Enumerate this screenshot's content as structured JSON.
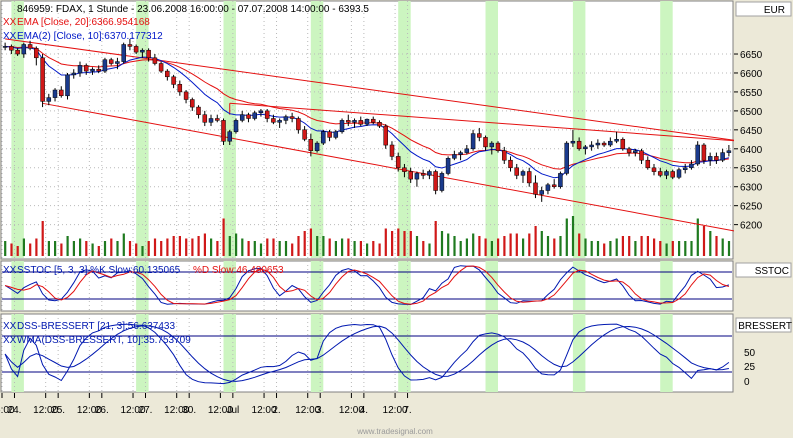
{
  "header": {
    "title": "846959: FDAX, 1 Stunde - 23.06.2008 16:00:00 - 07.07.2008 14:00:00 - 6393.5",
    "ema20": "EMA [Close, 20]:6366.954168",
    "ema10": "EMA(2) [Close, 10]:6370.177312",
    "currency": "EUR"
  },
  "panes": {
    "sstoc": {
      "title_k": "SSTOC [5, 3, 3] %K Slow:60.135065",
      "title_d": "%D Slow:46.480653",
      "axis_label": "SSTOC"
    },
    "dss": {
      "title1": "DSS-BRESSERT [21, 3]:56.637433",
      "title2": "WMA(DSS-BRESSERT, 10]:35.753709",
      "axis_label": "BRESSERT",
      "ticks": [
        "50",
        "25",
        "0"
      ]
    }
  },
  "x_labels": [
    "16:00",
    "24.",
    "12:00",
    "25.",
    "12:00",
    "26.",
    "12:00",
    "27.",
    "12:00",
    "30.",
    "12:00",
    "Jul",
    "12:00",
    "2.",
    "12:00",
    "3.",
    "12:00",
    "4.",
    "12:00",
    "7."
  ],
  "watermark": "www.tradesignal.com",
  "colors": {
    "up": "#1a3a8c",
    "down": "#d01818",
    "ema20": "#e41010",
    "ema10": "#0018c8",
    "green_band": "#ccf5c0",
    "grid": "#b9b9b9",
    "background": "#ffffff",
    "k_line": "#0018b0",
    "d_line": "#e41010"
  },
  "chart_data": [
    {
      "type": "candlestick",
      "title": "846959: FDAX, 1 Stunde - 23.06.2008 16:00:00 - 07.07.2008 14:00:00 - 6393.5",
      "y_ticks": [
        6650,
        6600,
        6550,
        6500,
        6450,
        6400,
        6350,
        6300,
        6250,
        6200
      ],
      "ylim": [
        6170,
        6745
      ],
      "volume_unit": "relative",
      "candles": [
        [
          6668,
          6680,
          6660,
          6670,
          0.3
        ],
        [
          6670,
          6675,
          6650,
          6660,
          0.25
        ],
        [
          6660,
          6665,
          6645,
          6650,
          0.2
        ],
        [
          6650,
          6680,
          6640,
          6675,
          0.35
        ],
        [
          6675,
          6685,
          6660,
          6665,
          0.25
        ],
        [
          6665,
          6670,
          6620,
          6640,
          0.35
        ],
        [
          6640,
          6650,
          6510,
          6525,
          0.7
        ],
        [
          6525,
          6545,
          6515,
          6535,
          0.3
        ],
        [
          6535,
          6560,
          6525,
          6555,
          0.3
        ],
        [
          6555,
          6565,
          6535,
          6540,
          0.25
        ],
        [
          6540,
          6600,
          6530,
          6595,
          0.4
        ],
        [
          6595,
          6610,
          6585,
          6600,
          0.3
        ],
        [
          6600,
          6630,
          6590,
          6620,
          0.35
        ],
        [
          6620,
          6625,
          6595,
          6605,
          0.3
        ],
        [
          6605,
          6615,
          6595,
          6610,
          0.25
        ],
        [
          6610,
          6620,
          6600,
          6605,
          0.2
        ],
        [
          6605,
          6640,
          6600,
          6635,
          0.3
        ],
        [
          6635,
          6640,
          6620,
          6625,
          0.35
        ],
        [
          6625,
          6640,
          6610,
          6630,
          0.3
        ],
        [
          6630,
          6680,
          6625,
          6675,
          0.45
        ],
        [
          6675,
          6690,
          6660,
          6670,
          0.3
        ],
        [
          6670,
          6675,
          6650,
          6655,
          0.25
        ],
        [
          6655,
          6665,
          6640,
          6660,
          0.2
        ],
        [
          6660,
          6665,
          6630,
          6640,
          0.3
        ],
        [
          6640,
          6650,
          6620,
          6625,
          0.35
        ],
        [
          6625,
          6630,
          6600,
          6605,
          0.3
        ],
        [
          6605,
          6610,
          6580,
          6590,
          0.35
        ],
        [
          6590,
          6595,
          6560,
          6570,
          0.4
        ],
        [
          6570,
          6580,
          6540,
          6550,
          0.4
        ],
        [
          6550,
          6555,
          6520,
          6530,
          0.35
        ],
        [
          6530,
          6535,
          6500,
          6510,
          0.35
        ],
        [
          6510,
          6515,
          6480,
          6490,
          0.4
        ],
        [
          6490,
          6500,
          6460,
          6470,
          0.45
        ],
        [
          6470,
          6490,
          6460,
          6480,
          0.35
        ],
        [
          6480,
          6490,
          6470,
          6475,
          0.3
        ],
        [
          6475,
          6480,
          6410,
          6420,
          0.75
        ],
        [
          6420,
          6450,
          6410,
          6445,
          0.4
        ],
        [
          6445,
          6480,
          6440,
          6475,
          0.45
        ],
        [
          6475,
          6500,
          6470,
          6490,
          0.35
        ],
        [
          6490,
          6495,
          6470,
          6480,
          0.3
        ],
        [
          6480,
          6500,
          6475,
          6495,
          0.3
        ],
        [
          6495,
          6505,
          6485,
          6500,
          0.25
        ],
        [
          6500,
          6505,
          6470,
          6480,
          0.35
        ],
        [
          6480,
          6490,
          6465,
          6470,
          0.35
        ],
        [
          6470,
          6480,
          6455,
          6475,
          0.3
        ],
        [
          6475,
          6490,
          6465,
          6485,
          0.3
        ],
        [
          6485,
          6495,
          6470,
          6480,
          0.25
        ],
        [
          6480,
          6485,
          6440,
          6450,
          0.4
        ],
        [
          6450,
          6460,
          6420,
          6425,
          0.5
        ],
        [
          6425,
          6440,
          6380,
          6395,
          0.55
        ],
        [
          6395,
          6420,
          6390,
          6415,
          0.4
        ],
        [
          6415,
          6450,
          6410,
          6445,
          0.4
        ],
        [
          6445,
          6450,
          6420,
          6430,
          0.35
        ],
        [
          6430,
          6450,
          6425,
          6445,
          0.3
        ],
        [
          6445,
          6480,
          6440,
          6475,
          0.35
        ],
        [
          6475,
          6490,
          6460,
          6470,
          0.35
        ],
        [
          6470,
          6480,
          6455,
          6475,
          0.3
        ],
        [
          6475,
          6485,
          6460,
          6465,
          0.3
        ],
        [
          6465,
          6480,
          6460,
          6478,
          0.25
        ],
        [
          6478,
          6485,
          6465,
          6470,
          0.3
        ],
        [
          6470,
          6475,
          6455,
          6460,
          0.25
        ],
        [
          6460,
          6465,
          6400,
          6410,
          0.55
        ],
        [
          6410,
          6420,
          6370,
          6380,
          0.5
        ],
        [
          6380,
          6390,
          6340,
          6350,
          0.55
        ],
        [
          6350,
          6360,
          6325,
          6340,
          0.5
        ],
        [
          6340,
          6350,
          6310,
          6320,
          0.5
        ],
        [
          6320,
          6340,
          6300,
          6335,
          0.4
        ],
        [
          6335,
          6345,
          6320,
          6330,
          0.3
        ],
        [
          6330,
          6345,
          6320,
          6340,
          0.25
        ],
        [
          6340,
          6345,
          6280,
          6290,
          0.7
        ],
        [
          6290,
          6340,
          6285,
          6335,
          0.5
        ],
        [
          6335,
          6380,
          6330,
          6375,
          0.45
        ],
        [
          6375,
          6395,
          6370,
          6385,
          0.4
        ],
        [
          6385,
          6395,
          6370,
          6390,
          0.3
        ],
        [
          6390,
          6410,
          6385,
          6400,
          0.35
        ],
        [
          6400,
          6450,
          6395,
          6440,
          0.45
        ],
        [
          6440,
          6455,
          6420,
          6430,
          0.4
        ],
        [
          6430,
          6435,
          6395,
          6405,
          0.35
        ],
        [
          6405,
          6420,
          6385,
          6415,
          0.3
        ],
        [
          6415,
          6420,
          6390,
          6395,
          0.35
        ],
        [
          6395,
          6405,
          6360,
          6370,
          0.4
        ],
        [
          6370,
          6380,
          6340,
          6350,
          0.45
        ],
        [
          6350,
          6360,
          6320,
          6330,
          0.45
        ],
        [
          6330,
          6345,
          6310,
          6340,
          0.35
        ],
        [
          6340,
          6350,
          6300,
          6310,
          0.45
        ],
        [
          6310,
          6330,
          6270,
          6280,
          0.6
        ],
        [
          6280,
          6300,
          6260,
          6290,
          0.5
        ],
        [
          6290,
          6310,
          6280,
          6305,
          0.4
        ],
        [
          6305,
          6320,
          6295,
          6300,
          0.35
        ],
        [
          6300,
          6340,
          6295,
          6335,
          0.4
        ],
        [
          6335,
          6420,
          6330,
          6415,
          0.75
        ],
        [
          6415,
          6450,
          6405,
          6420,
          0.8
        ],
        [
          6420,
          6430,
          6395,
          6400,
          0.45
        ],
        [
          6400,
          6410,
          6385,
          6405,
          0.35
        ],
        [
          6405,
          6420,
          6395,
          6410,
          0.3
        ],
        [
          6410,
          6425,
          6400,
          6415,
          0.3
        ],
        [
          6415,
          6420,
          6405,
          6410,
          0.25
        ],
        [
          6410,
          6430,
          6405,
          6420,
          0.3
        ],
        [
          6420,
          6445,
          6415,
          6425,
          0.35
        ],
        [
          6425,
          6430,
          6395,
          6400,
          0.4
        ],
        [
          6400,
          6405,
          6380,
          6390,
          0.4
        ],
        [
          6390,
          6400,
          6380,
          6395,
          0.3
        ],
        [
          6395,
          6400,
          6360,
          6370,
          0.4
        ],
        [
          6370,
          6380,
          6345,
          6350,
          0.4
        ],
        [
          6350,
          6360,
          6330,
          6340,
          0.35
        ],
        [
          6340,
          6350,
          6325,
          6330,
          0.3
        ],
        [
          6330,
          6345,
          6320,
          6340,
          0.25
        ],
        [
          6340,
          6345,
          6320,
          6325,
          0.3
        ],
        [
          6325,
          6350,
          6320,
          6345,
          0.3
        ],
        [
          6345,
          6360,
          6335,
          6350,
          0.3
        ],
        [
          6350,
          6370,
          6345,
          6360,
          0.3
        ],
        [
          6360,
          6420,
          6355,
          6410,
          0.75
        ],
        [
          6410,
          6415,
          6360,
          6370,
          0.6
        ],
        [
          6370,
          6390,
          6355,
          6380,
          0.5
        ],
        [
          6380,
          6390,
          6360,
          6370,
          0.4
        ],
        [
          6370,
          6400,
          6365,
          6390,
          0.35
        ],
        [
          6390,
          6410,
          6380,
          6395,
          0.3
        ]
      ],
      "series": [
        {
          "name": "EMA [Close, 20]",
          "last": 6366.954168
        },
        {
          "name": "EMA(2) [Close, 10]",
          "last": 6370.177312
        }
      ]
    },
    {
      "type": "line",
      "title": "SSTOC [5, 3, 3]",
      "ylim": [
        0,
        100
      ],
      "reference_lines": [
        80,
        20
      ],
      "series": [
        {
          "name": "%K Slow",
          "last": 60.135065
        },
        {
          "name": "%D Slow",
          "last": 46.480653
        }
      ]
    },
    {
      "type": "line",
      "title": "DSS-BRESSERT [21, 3]",
      "ylim": [
        -10,
        110
      ],
      "y_ticks": [
        50,
        25,
        0
      ],
      "reference_lines": [
        80,
        20
      ],
      "series": [
        {
          "name": "DSS-BRESSERT [21, 3]",
          "last": 56.637433
        },
        {
          "name": "WMA(DSS-BRESSERT, 10]",
          "last": 35.753709
        }
      ]
    }
  ]
}
